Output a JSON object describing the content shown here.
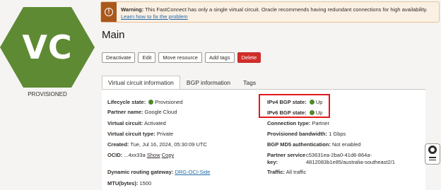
{
  "resource": {
    "icon_initials": "VC",
    "state": "PROVISIONED",
    "icon_color": "#5f8a34"
  },
  "warning": {
    "title": "Warning:",
    "message": "This FastConnect has only a single virtual circuit. Oracle recommends having redundant connections for high availability.",
    "link": "Learn how to fix the problem"
  },
  "page_title": "Main",
  "actions": {
    "deactivate": "Deactivate",
    "edit": "Edit",
    "move": "Move resource",
    "tags": "Add tags",
    "delete": "Delete"
  },
  "tabs": {
    "info": "Virtual circuit information",
    "bgp": "BGP information",
    "tags": "Tags"
  },
  "info": {
    "lifecycle_label": "Lifecycle state:",
    "lifecycle_value": "Provisioned",
    "partner_label": "Partner name:",
    "partner_value": "Google Cloud",
    "vc_label": "Virtual circuit:",
    "vc_value": "Activated",
    "vc_type_label": "Virtual circuit type:",
    "vc_type_value": "Private",
    "created_label": "Created:",
    "created_value": "Tue, Jul 16, 2024, 05:30:09 UTC",
    "ocid_label": "OCID:",
    "ocid_value": "...4xx33a",
    "ocid_show": "Show",
    "ocid_copy": "Copy",
    "drg_label": "Dynamic routing gateway:",
    "drg_value": "DRG-OCI-Side",
    "mtu_label": "MTU(bytes):",
    "mtu_value": "1500",
    "ipv4_label": "IPv4 BGP state:",
    "ipv4_value": "Up",
    "ipv6_label": "IPv6 BGP state:",
    "ipv6_value": "Up",
    "conn_type_label": "Connection type:",
    "conn_type_value": "Partner",
    "bandwidth_label": "Provisioned bandwidth:",
    "bandwidth_value": "1 Gbps",
    "md5_label": "BGP MD5 authentication:",
    "md5_value": "Not enabled",
    "service_key_label_1": "Partner service",
    "service_key_label_2": "key:",
    "service_key_value_1": "c53631ea-2ba0-41d6-864a-",
    "service_key_value_2": "4812083b1e85/australia-southeast2/1",
    "traffic_label": "Traffic:",
    "traffic_value": "All traffic"
  },
  "colors": {
    "status_green": "#4b8a2b",
    "delete_red": "#d12e2a",
    "highlight_red": "#e2191e"
  }
}
